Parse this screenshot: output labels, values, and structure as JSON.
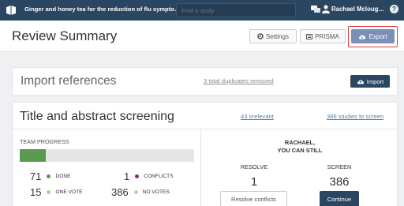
{
  "topbar": {
    "study_title": "Ginger and honey tea for the reduction of flu sympto…",
    "search_placeholder": "Find a study",
    "user_name": "Rachael Mcloug…",
    "help_label": "?"
  },
  "header": {
    "title": "Review Summary",
    "settings_label": "Settings",
    "prisma_label": "PRISMA",
    "export_label": "Export"
  },
  "import": {
    "title": "Import references",
    "duplicates_link": "3 total duplicates removed",
    "button_label": "Import"
  },
  "screening": {
    "title": "Title and abstract screening",
    "irrelevant_link": "43 irrelevant",
    "to_screen_link": "386 studies to screen",
    "team_progress_label": "TEAM PROGRESS",
    "progress_fraction": 0.15,
    "stats": {
      "done": {
        "value": "71",
        "label": "DONE",
        "color": "#5a9a4e"
      },
      "conflicts": {
        "value": "1",
        "label": "CONFLICTS",
        "color": "#8b2a7a"
      },
      "one_vote": {
        "value": "15",
        "label": "ONE VOTE",
        "color": "#a8d49a"
      },
      "no_votes": {
        "value": "386",
        "label": "NO VOTES",
        "color": "#c8cbce"
      }
    },
    "greeting_line1": "RACHAEL,",
    "greeting_line2": "YOU CAN STILL",
    "resolve": {
      "label": "RESOLVE",
      "value": "1",
      "button": "Resolve conflicts"
    },
    "screen": {
      "label": "SCREEN",
      "value": "386",
      "button": "Continue"
    }
  }
}
